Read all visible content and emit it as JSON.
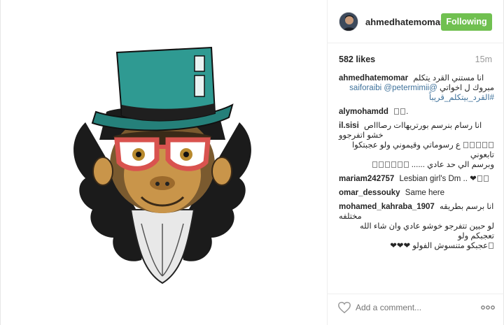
{
  "post": {
    "author": "ahmedhatemomar",
    "follow_label": "Following",
    "likes": "582 likes",
    "time_ago": "15m"
  },
  "caption": {
    "user": "ahmedhatemomar",
    "line1": "انا مستني القرد يتكلم",
    "line2_prefix": "مبروك ل اخواتي",
    "mention1": "@saiforaibi",
    "mention2": "@petermimii",
    "hashtag": "#القرد_بيتكلم_قريباً"
  },
  "comments": [
    {
      "user": "alymohamdd",
      "text": "."
    },
    {
      "user": "il.sisi",
      "text1": "انا رسام بنرسم بورتريهاات رصاااص خشو اتفرجوو",
      "text2": "ع رسوماتي وقيموني ولو عجبتكوا تابعوني",
      "text3": "وبرسم الي حد عادي ......"
    },
    {
      "user": "mariam242757",
      "text": "Lesbian girl's Dm .. ❤"
    },
    {
      "user": "omar_dessouky",
      "text": "Same here"
    },
    {
      "user": "mohamed_kahraba_1907",
      "text1": "انا برسم بطريقه مختلفه",
      "text2": "لو حبين تتفرجو خوشو عادي وان شاء الله تعجبكم ولو",
      "text3": "عجبكو متنسوش الفولو ❤❤❤"
    }
  ],
  "footer": {
    "add_comment_placeholder": "Add a comment..."
  },
  "colors": {
    "follow_button": "#70c050",
    "mention": "#3f729b",
    "hat": "#2f9a92"
  },
  "icons": {
    "like": "heart-icon",
    "more": "more-options-icon"
  }
}
